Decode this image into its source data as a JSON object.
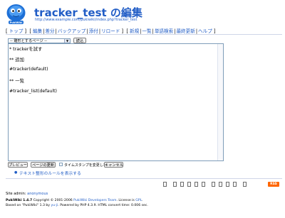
{
  "page": {
    "title": "tracker_test の編集",
    "url": "http://www.example.com/pukiwiki/index.php?tracker_test",
    "logo_text": "PukiWiki"
  },
  "nav": {
    "groups": [
      [
        "トップ"
      ],
      [
        "編集",
        "差分",
        "バックアップ",
        "添付",
        "リロード"
      ],
      [
        "新規",
        "一覧",
        "単語検索",
        "最終更新",
        "ヘルプ"
      ]
    ]
  },
  "editor": {
    "template_select": "-- 雛形とするページ --",
    "load_button": "読込",
    "content": [
      "* trackerを試す",
      "** 追加",
      "#tracker(default)",
      "** 一覧",
      "#tracker_list(default)"
    ]
  },
  "actions": {
    "preview_button": "プレビュー",
    "update_button": "ページの更新",
    "notimestamp_label": "タイムスタンプを変更しない",
    "notimestamp_checked": false,
    "cancel_button": "キャンセル",
    "rules_link": "テキスト整形のルールを表示する"
  },
  "toolbar": {
    "icons": [
      "top-icon",
      "edit-icon",
      "diff-icon",
      "backup-icon",
      "attach-icon",
      "reload-icon",
      "new-icon",
      "list-icon",
      "search-icon",
      "recent-icon",
      "help-icon"
    ],
    "rss_label": "RSS"
  },
  "footer": {
    "site_admin_label": "Site admin:",
    "site_admin_name": "anonymous",
    "line1": {
      "app": "PukiWiki 1.4.7",
      "copyright": "Copyright © 2001-2006",
      "team": "PukiWiki Developers Team",
      "license_text": ". License is",
      "license": "GPL",
      "end": "."
    },
    "line2": {
      "prefix": "Based on \"PukiWiki\" 1.3 by",
      "author": "yu-ji",
      "rest": ". Powered by PHP 4.3.9. HTML convert time: 0.006 sec."
    }
  },
  "colors": {
    "link": "#215dc6",
    "accent_rss": "#ff6600"
  }
}
